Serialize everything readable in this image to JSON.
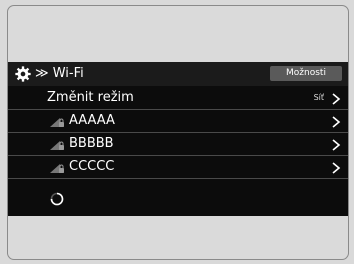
{
  "header": {
    "title": "≫ Wi-Fi",
    "options_label": "Možnosti",
    "settings_icon": "gear-icon"
  },
  "rows": [
    {
      "label": "Změnit režim",
      "value": "Síť",
      "icon": "chevron-right-icon"
    },
    {
      "label": "AAAAA",
      "icon": "wifi-locked-icon"
    },
    {
      "label": "BBBBB",
      "icon": "wifi-locked-icon"
    },
    {
      "label": "CCCCC",
      "icon": "wifi-locked-icon"
    }
  ],
  "status": {
    "icon": "loading-spinner-icon"
  },
  "colors": {
    "screen": "#0c0c0c",
    "header": "#1b1b1b",
    "button": "#5a5a5a",
    "divider": "#4a4a4a"
  }
}
